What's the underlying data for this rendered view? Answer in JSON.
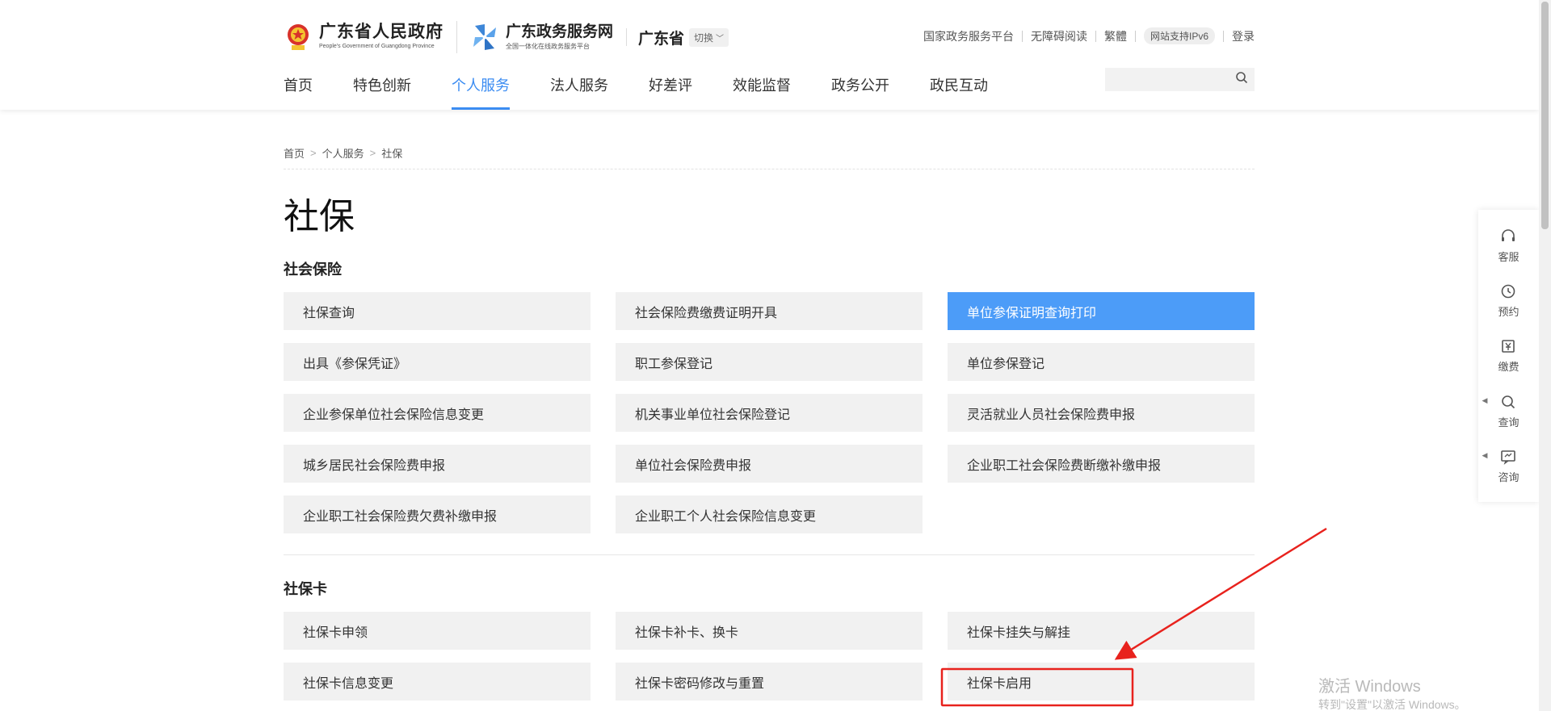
{
  "header": {
    "gov_title": "广东省人民政府",
    "gov_subtitle": "People's Government of Guangdong Province",
    "portal_title": "广东政务服务网",
    "portal_subtitle": "全国一体化在线政务服务平台",
    "region": "广东省",
    "switch_label": "切换",
    "top_links": [
      "国家政务服务平台",
      "无障碍阅读",
      "繁體",
      "网站支持IPv6",
      "登录"
    ],
    "nav": [
      "首页",
      "特色创新",
      "个人服务",
      "法人服务",
      "好差评",
      "效能监督",
      "政务公开",
      "政民互动"
    ],
    "nav_active": "个人服务",
    "search_placeholder": ""
  },
  "breadcrumb": [
    "首页",
    "个人服务",
    "社保"
  ],
  "page_title": "社保",
  "sections": [
    {
      "title": "社会保险",
      "items": [
        "社保查询",
        "社会保险费缴费证明开具",
        "单位参保证明查询打印",
        "出具《参保凭证》",
        "职工参保登记",
        "单位参保登记",
        "企业参保单位社会保险信息变更",
        "机关事业单位社会保险登记",
        "灵活就业人员社会保险费申报",
        "城乡居民社会保险费申报",
        "单位社会保险费申报",
        "企业职工社会保险费断缴补缴申报",
        "企业职工社会保险费欠费补缴申报",
        "企业职工个人社会保险信息变更"
      ],
      "highlighted": "单位参保证明查询打印"
    },
    {
      "title": "社保卡",
      "items": [
        "社保卡申领",
        "社保卡补卡、换卡",
        "社保卡挂失与解挂",
        "社保卡信息变更",
        "社保卡密码修改与重置",
        "社保卡启用"
      ]
    }
  ],
  "floatbar": [
    "客服",
    "预约",
    "缴费",
    "查询",
    "咨询"
  ],
  "watermark": {
    "line1": "激活 Windows",
    "line2": "转到\"设置\"以激活 Windows。"
  },
  "colors": {
    "accent": "#3b8cf2",
    "highlight_tile": "#4c9cf8",
    "annotation": "#e8221d"
  }
}
